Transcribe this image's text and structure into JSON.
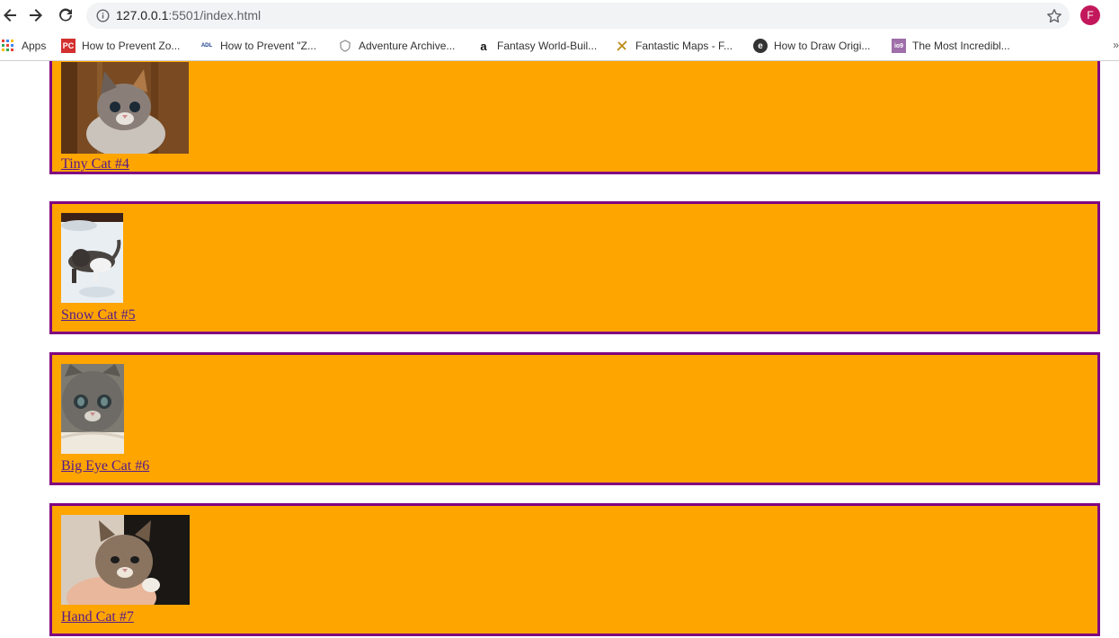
{
  "browser": {
    "url_host": "127.0.0.1",
    "url_path": ":5501/index.html",
    "profile_initial": "F",
    "bookmarks": [
      {
        "label": "Apps",
        "icon": "apps-grid-icon"
      },
      {
        "label": "How to Prevent Zo...",
        "icon": "pc-favicon"
      },
      {
        "label": "How to Prevent \"Z...",
        "icon": "adl-favicon"
      },
      {
        "label": "Adventure Archive...",
        "icon": "shield-favicon"
      },
      {
        "label": "Fantasy World-Buil...",
        "icon": "amazon-favicon"
      },
      {
        "label": "Fantastic Maps - F...",
        "icon": "compass-favicon"
      },
      {
        "label": "How to Draw Origi...",
        "icon": "e-favicon"
      },
      {
        "label": "The Most Incredibl...",
        "icon": "io9-favicon"
      }
    ],
    "bookmarks_more": "»"
  },
  "cards": [
    {
      "caption": "Tiny Cat #4"
    },
    {
      "caption": "Snow Cat #5"
    },
    {
      "caption": "Big Eye Cat #6"
    },
    {
      "caption": "Hand Cat #7"
    }
  ],
  "colors": {
    "card_background": "#ffa500",
    "card_border": "#800080",
    "link_visited": "#551a8b"
  }
}
